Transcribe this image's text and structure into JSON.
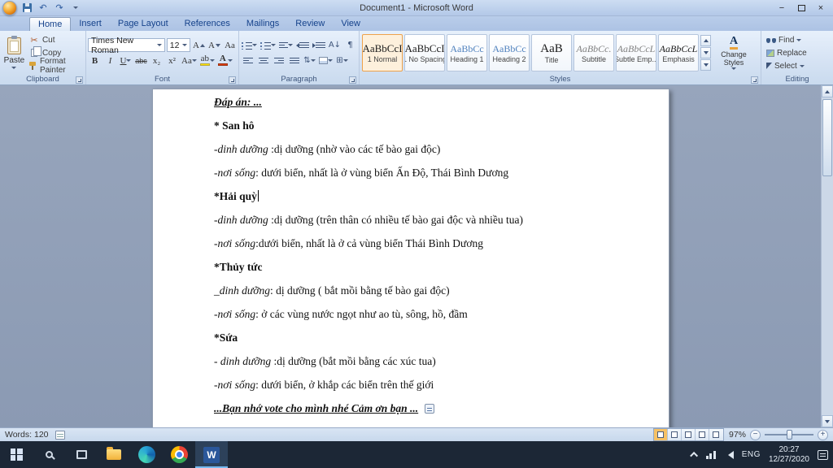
{
  "titlebar": {
    "title": "Document1 - Microsoft Word",
    "controls": {
      "minimize": "−",
      "close": "×"
    }
  },
  "icons": {
    "undo": "↶",
    "redo": "↷",
    "cut": "✂",
    "pilcrow": "¶",
    "sort": "A↓",
    "line_spacing": "⇅",
    "borders": "⊞",
    "word_logo_letter": "W"
  },
  "ribbon": {
    "tabs": [
      {
        "label": "Home",
        "active": true
      },
      {
        "label": "Insert"
      },
      {
        "label": "Page Layout"
      },
      {
        "label": "References"
      },
      {
        "label": "Mailings"
      },
      {
        "label": "Review"
      },
      {
        "label": "View"
      }
    ],
    "clipboard": {
      "group_label": "Clipboard",
      "paste_label": "Paste",
      "cut_label": "Cut",
      "copy_label": "Copy",
      "format_painter_label": "Format Painter"
    },
    "font": {
      "group_label": "Font",
      "family": "Times New Roman",
      "size": "12",
      "buttons": {
        "bold": "B",
        "italic": "I",
        "underline": "U",
        "strikethrough": "abc",
        "subscript": "x₂",
        "superscript": "x²",
        "change_case": "Aa",
        "grow_font": "A",
        "shrink_font": "A",
        "clear_formatting": "Aa",
        "highlight": "ab",
        "font_color": "A"
      }
    },
    "paragraph": {
      "group_label": "Paragraph"
    },
    "styles": {
      "group_label": "Styles",
      "change_styles_label": "Change Styles",
      "change_styles_icon_letter": "A",
      "items": [
        {
          "preview": "AaBbCcI",
          "name": "1 Normal",
          "selected": true
        },
        {
          "preview": "AaBbCcI",
          "name": "1 No Spacing"
        },
        {
          "preview": "AaBbCc",
          "name": "Heading 1",
          "kind": "heading"
        },
        {
          "preview": "AaBbCc",
          "name": "Heading 2",
          "kind": "heading"
        },
        {
          "preview": "AaB",
          "name": "Title",
          "kind": "title"
        },
        {
          "preview": "AaBbCc.",
          "name": "Subtitle",
          "kind": "subtle"
        },
        {
          "preview": "AaBbCcL",
          "name": "Subtle Emp...",
          "kind": "subtle"
        },
        {
          "preview": "AaBbCcL",
          "name": "Emphasis",
          "kind": "emphasis"
        }
      ]
    },
    "editing": {
      "group_label": "Editing",
      "find_label": "Find",
      "replace_label": "Replace",
      "select_label": "Select"
    }
  },
  "document": {
    "paragraphs": [
      {
        "segments": [
          {
            "text": "Đáp án: ...",
            "b": true,
            "i": true,
            "u": true
          }
        ]
      },
      {
        "segments": [
          {
            "text": "* San hô",
            "b": true
          }
        ]
      },
      {
        "segments": [
          {
            "text": "-dinh dưỡng ",
            "i": true
          },
          {
            "text": ":dị dưỡng (nhờ vào các tế bào gai độc)"
          }
        ]
      },
      {
        "segments": [
          {
            "text": "-nơi sống",
            "i": true
          },
          {
            "text": ": dưới biển, nhất là ở vùng biển Ấn Độ, Thái Bình Dương"
          }
        ]
      },
      {
        "segments": [
          {
            "text": "*Hải quỳ",
            "b": true
          }
        ],
        "cursor": true
      },
      {
        "segments": [
          {
            "text": "-dinh dưỡng ",
            "i": true
          },
          {
            "text": ":dị dưỡng (trên thân có nhiều tế bào gai độc và nhiều tua)"
          }
        ]
      },
      {
        "segments": [
          {
            "text": "-nơi sống",
            "i": true
          },
          {
            "text": ":dưới biển, nhất là ở cả vùng biển Thái Bình Dương"
          }
        ]
      },
      {
        "segments": [
          {
            "text": "*Thủy tức",
            "b": true
          }
        ]
      },
      {
        "segments": [
          {
            "text": "_dinh dưỡng",
            "i": true
          },
          {
            "text": ": dị dưỡng ( bắt mồi bằng tế bào gai độc)"
          }
        ]
      },
      {
        "segments": [
          {
            "text": "-nơi sống",
            "i": true
          },
          {
            "text": ": ở các vùng nước ngọt như ao tù, sông, hồ, đầm"
          }
        ]
      },
      {
        "segments": [
          {
            "text": "*Sứa",
            "b": true
          }
        ]
      },
      {
        "segments": [
          {
            "text": "- dinh dưỡng ",
            "i": true
          },
          {
            "text": ":dị dưỡng (bắt mồi bằng các xúc tua)"
          }
        ]
      },
      {
        "segments": [
          {
            "text": "-nơi sống",
            "i": true
          },
          {
            "text": ": dưới biển, ở khắp các biển trên thế giới"
          }
        ]
      },
      {
        "segments": [
          {
            "text": "...Bạn nhớ vote cho mình nhé   Cảm ơn bạn ...",
            "b": true,
            "i": true,
            "u": true
          }
        ],
        "icon": "paste-options-icon"
      }
    ]
  },
  "statusbar": {
    "words": "Words: 120",
    "zoom": "97%",
    "zoom_out": "−",
    "zoom_in": "+"
  },
  "taskbar": {
    "lang": "ENG",
    "time": "20:27",
    "date": "12/27/2020"
  }
}
